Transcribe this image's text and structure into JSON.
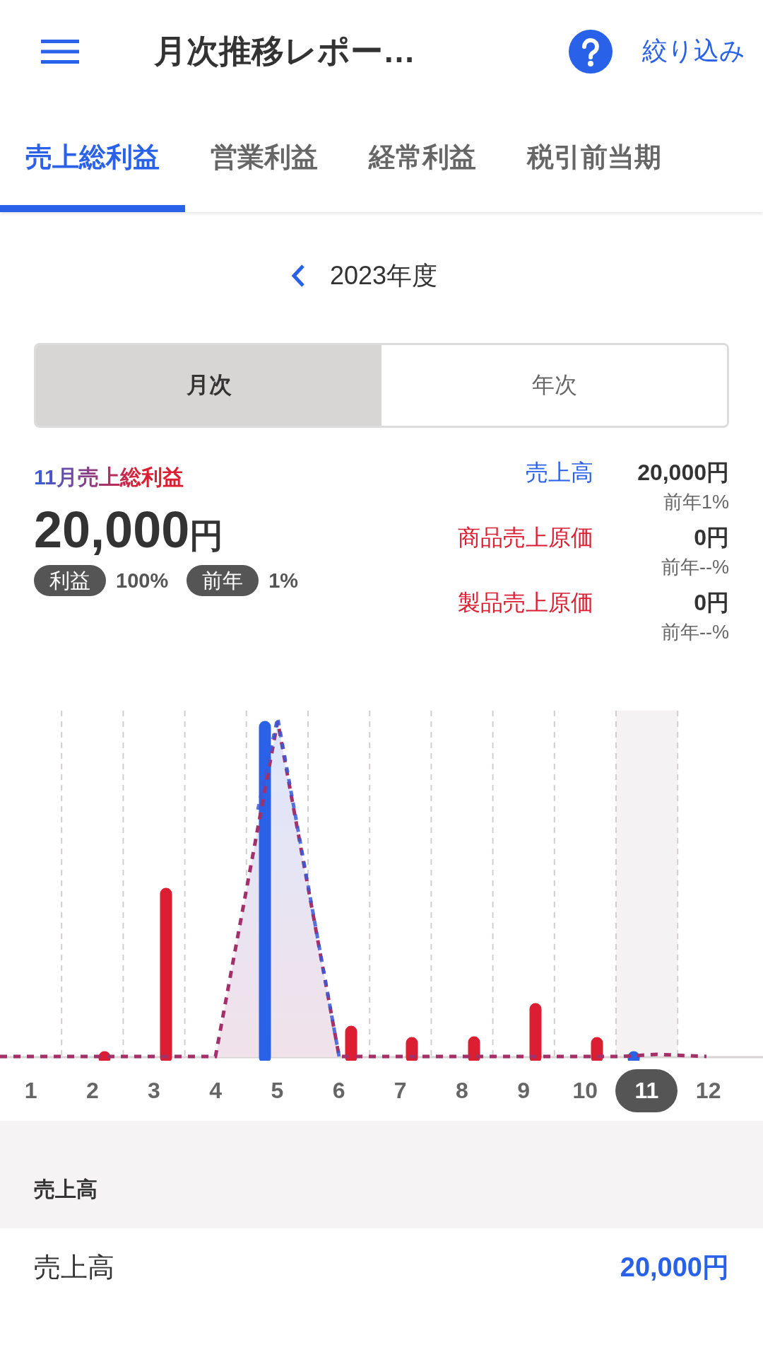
{
  "header": {
    "title": "月次推移レポー…",
    "filter_link": "絞り込み"
  },
  "tabs": [
    {
      "label": "売上総利益",
      "selected": true
    },
    {
      "label": "営業利益",
      "selected": false
    },
    {
      "label": "経常利益",
      "selected": false
    },
    {
      "label": "税引前当期",
      "selected": false
    }
  ],
  "period": {
    "label": "2023年度"
  },
  "segments": [
    {
      "label": "月次",
      "selected": true
    },
    {
      "label": "年次",
      "selected": false
    }
  ],
  "summary": {
    "title": "11月売上総利益",
    "amount": "20,000",
    "unit": "円",
    "chips": [
      {
        "label": "利益",
        "value": "100%"
      },
      {
        "label": "前年",
        "value": "1%"
      }
    ]
  },
  "breakdown": [
    {
      "label": "売上高",
      "value": "20,000円",
      "change": "前年1%",
      "color": "#2962e8"
    },
    {
      "label": "商品売上原価",
      "value": "0円",
      "change": "前年--%",
      "color": "#dc1e32"
    },
    {
      "label": "製品売上原価",
      "value": "0円",
      "change": "前年--%",
      "color": "#dc1e32"
    }
  ],
  "chart": {
    "months": [
      {
        "label": "1",
        "selected": false
      },
      {
        "label": "2",
        "selected": false
      },
      {
        "label": "3",
        "selected": false
      },
      {
        "label": "4",
        "selected": false
      },
      {
        "label": "5",
        "selected": false
      },
      {
        "label": "6",
        "selected": false
      },
      {
        "label": "7",
        "selected": false
      },
      {
        "label": "8",
        "selected": false
      },
      {
        "label": "9",
        "selected": false
      },
      {
        "label": "10",
        "selected": false
      },
      {
        "label": "11",
        "selected": true
      },
      {
        "label": "12",
        "selected": false
      }
    ]
  },
  "section": {
    "title": "売上高",
    "rows": [
      {
        "label": "売上高",
        "value": "20,000円"
      }
    ]
  }
}
